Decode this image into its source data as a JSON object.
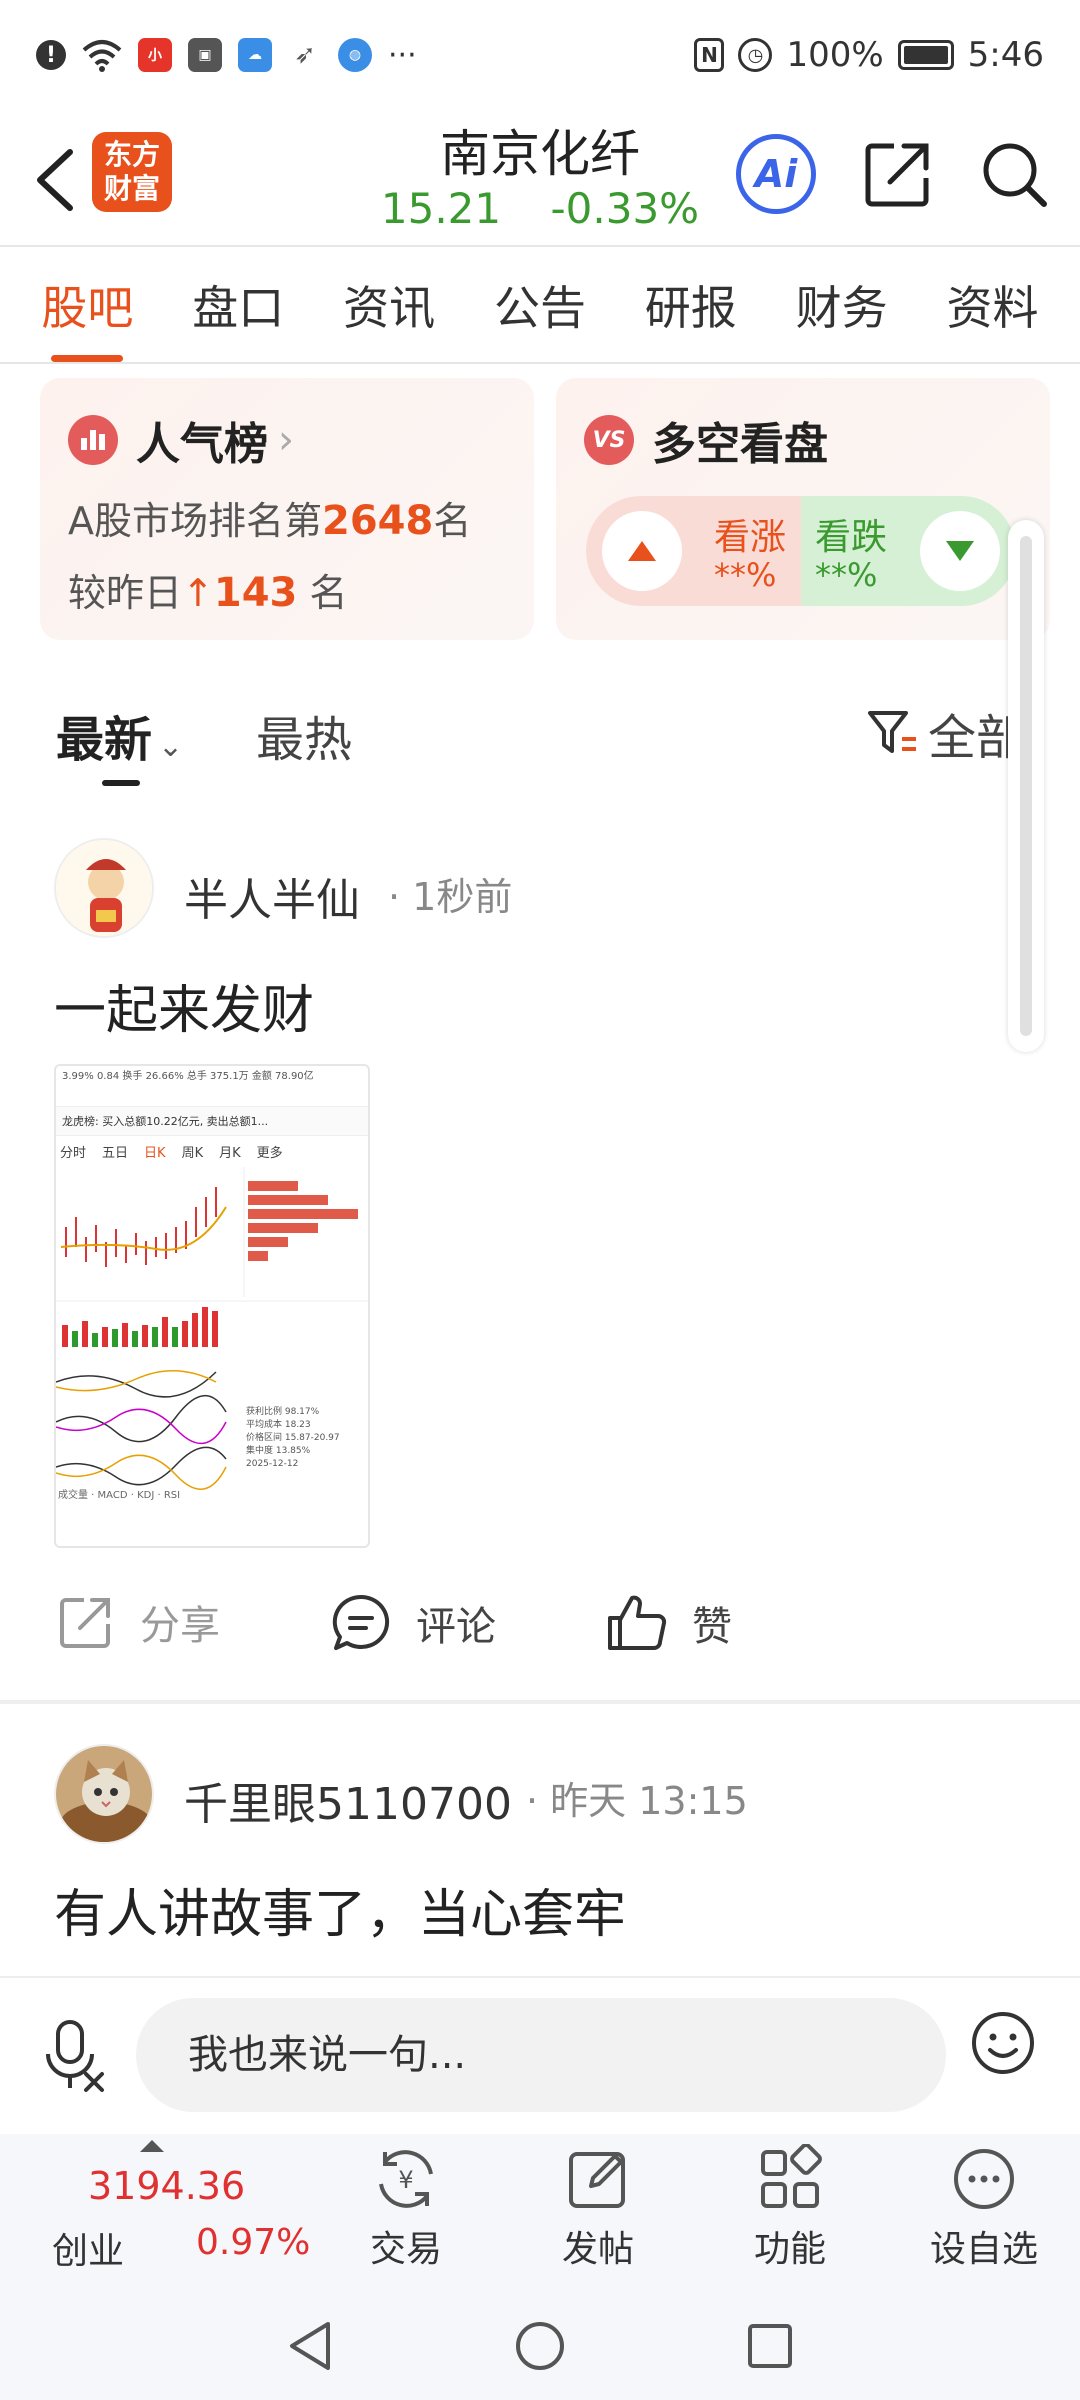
{
  "status_bar": {
    "battery": "100%",
    "time": "5:46",
    "more": "···"
  },
  "header": {
    "brand_line1": "东方",
    "brand_line2": "财富",
    "stock_name": "南京化纤",
    "price": "15.21",
    "change_pct": "-0.33%",
    "ai_label": "Ai"
  },
  "tabs": [
    "股吧",
    "盘口",
    "资讯",
    "公告",
    "研报",
    "财务",
    "资料"
  ],
  "popularity_card": {
    "title": "人气榜",
    "rank_prefix": "A股市场排名第",
    "rank": "2648",
    "rank_suffix": "名",
    "change_prefix": "较昨日",
    "change_value": "143",
    "change_suffix": "名"
  },
  "vs_card": {
    "title": "多空看盘",
    "bull_label": "看涨",
    "bull_value": "**%",
    "bear_label": "看跌",
    "bear_value": "**%"
  },
  "sort": {
    "latest": "最新",
    "hottest": "最热",
    "filter": "全部"
  },
  "posts": [
    {
      "user": "半人半仙",
      "time": "1秒前",
      "text": "一起来发财"
    },
    {
      "user": "千里眼5110700",
      "time": "昨天 13:15",
      "text": "有人讲故事了，当心套牢"
    }
  ],
  "thumbnail": {
    "top_line": "3.99%  0.84  换手 26.66%  总手 375.1万  金额 78.90亿",
    "tabs": [
      "分时",
      "五日",
      "日K",
      "周K",
      "月K",
      "更多"
    ],
    "notice": "龙虎榜: 买入总额10.22亿元, 卖出总额1...",
    "indicators": [
      "成交量",
      "MACD",
      "KDJ",
      "RSI"
    ],
    "chip_labels": [
      "获利比例 98.17%",
      "平均成本 18.23",
      "价格区间 15.87-20.97",
      "集中度 13.85%",
      "2025-12-12"
    ]
  },
  "actions": {
    "share": "分享",
    "comment": "评论",
    "like": "赞"
  },
  "comment_bar": {
    "placeholder": "我也来说一句..."
  },
  "bottom_nav": {
    "index_value": "3194.36",
    "index_name": "创业",
    "index_change": "0.97%",
    "items": [
      "交易",
      "发帖",
      "功能",
      "设自选"
    ]
  }
}
